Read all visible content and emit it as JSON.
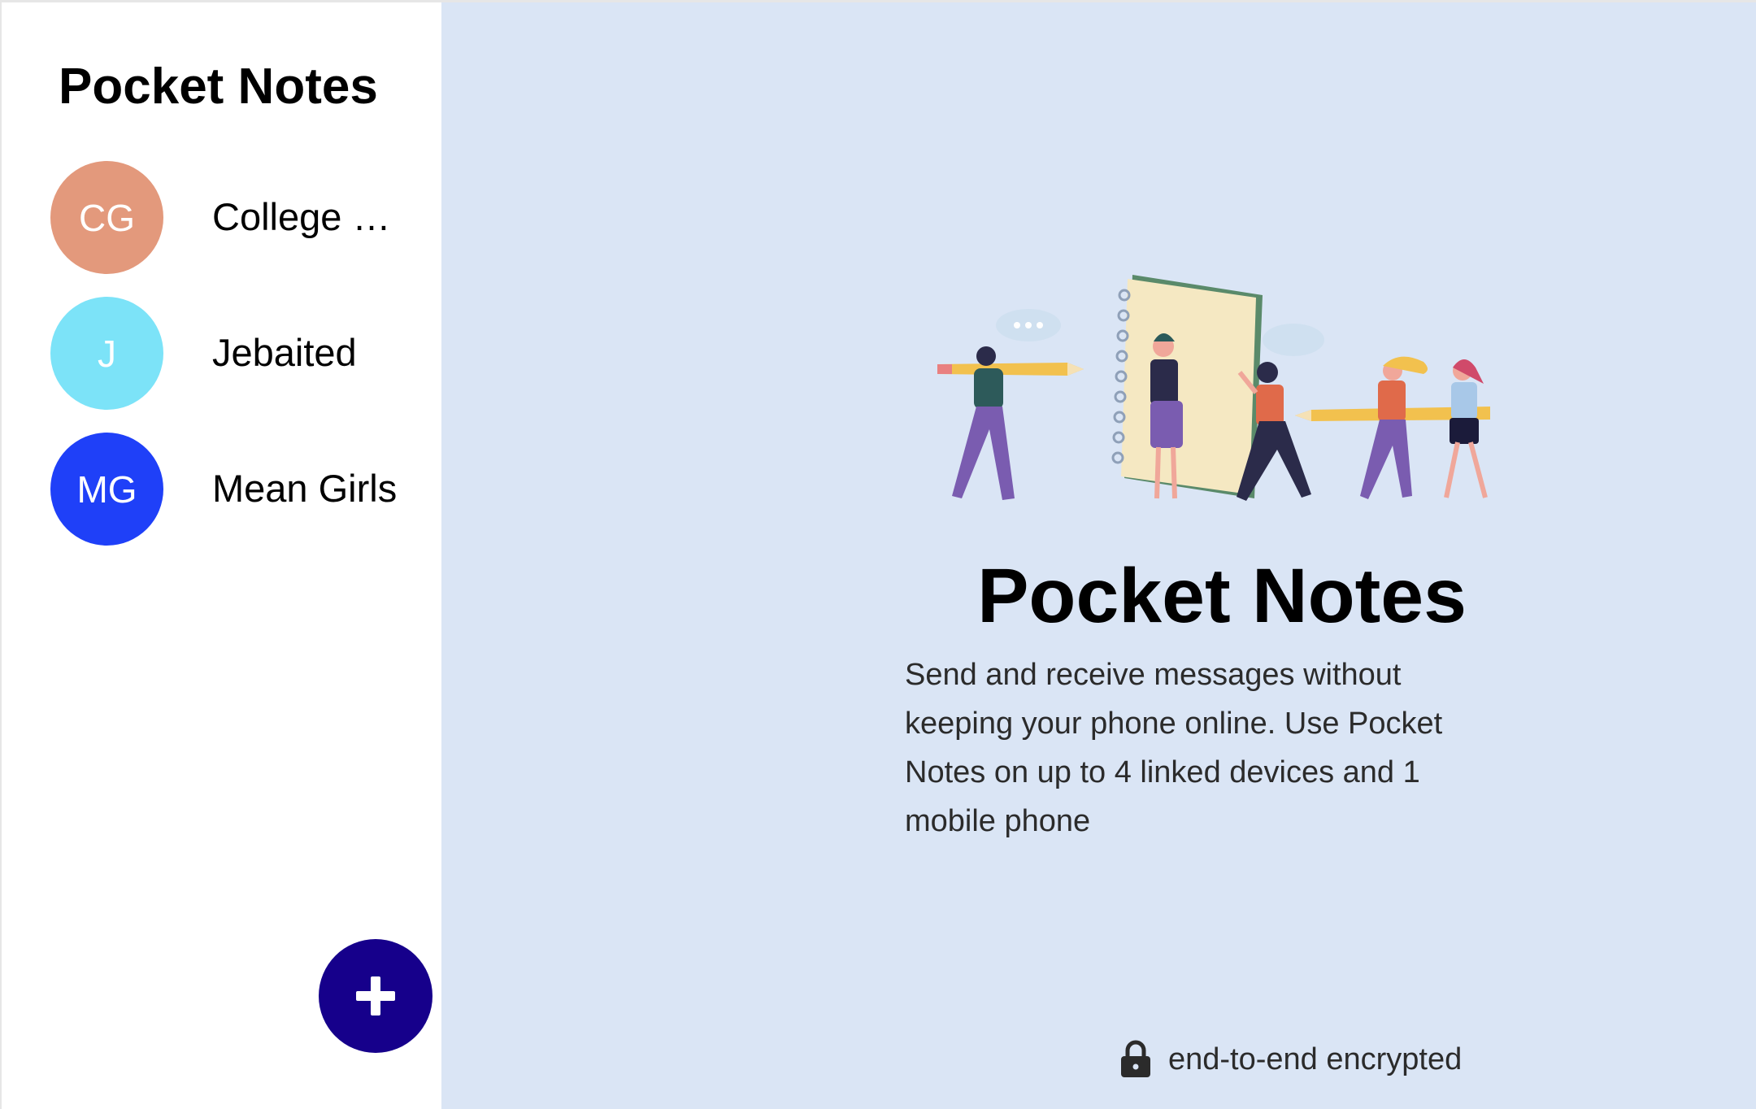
{
  "sidebar": {
    "title": "Pocket Notes",
    "groups": [
      {
        "initials": "CG",
        "name": "College …",
        "color": "#e3997c"
      },
      {
        "initials": "J",
        "name": "Jebaited",
        "color": "#7ce3f8"
      },
      {
        "initials": "MG",
        "name": "Mean Girls",
        "color": "#1f40f8"
      }
    ],
    "add_button": {
      "icon": "plus-icon",
      "color": "#16008b"
    }
  },
  "main": {
    "title": "Pocket Notes",
    "description": "Send and receive messages without keeping your phone online. Use Pocket Notes on up to 4 linked devices and 1 mobile phone",
    "footer_text": "end-to-end encrypted",
    "footer_icon": "lock-icon",
    "background": "#dae5f5",
    "illustration": "people-with-pencils-and-notebook-illustration"
  }
}
